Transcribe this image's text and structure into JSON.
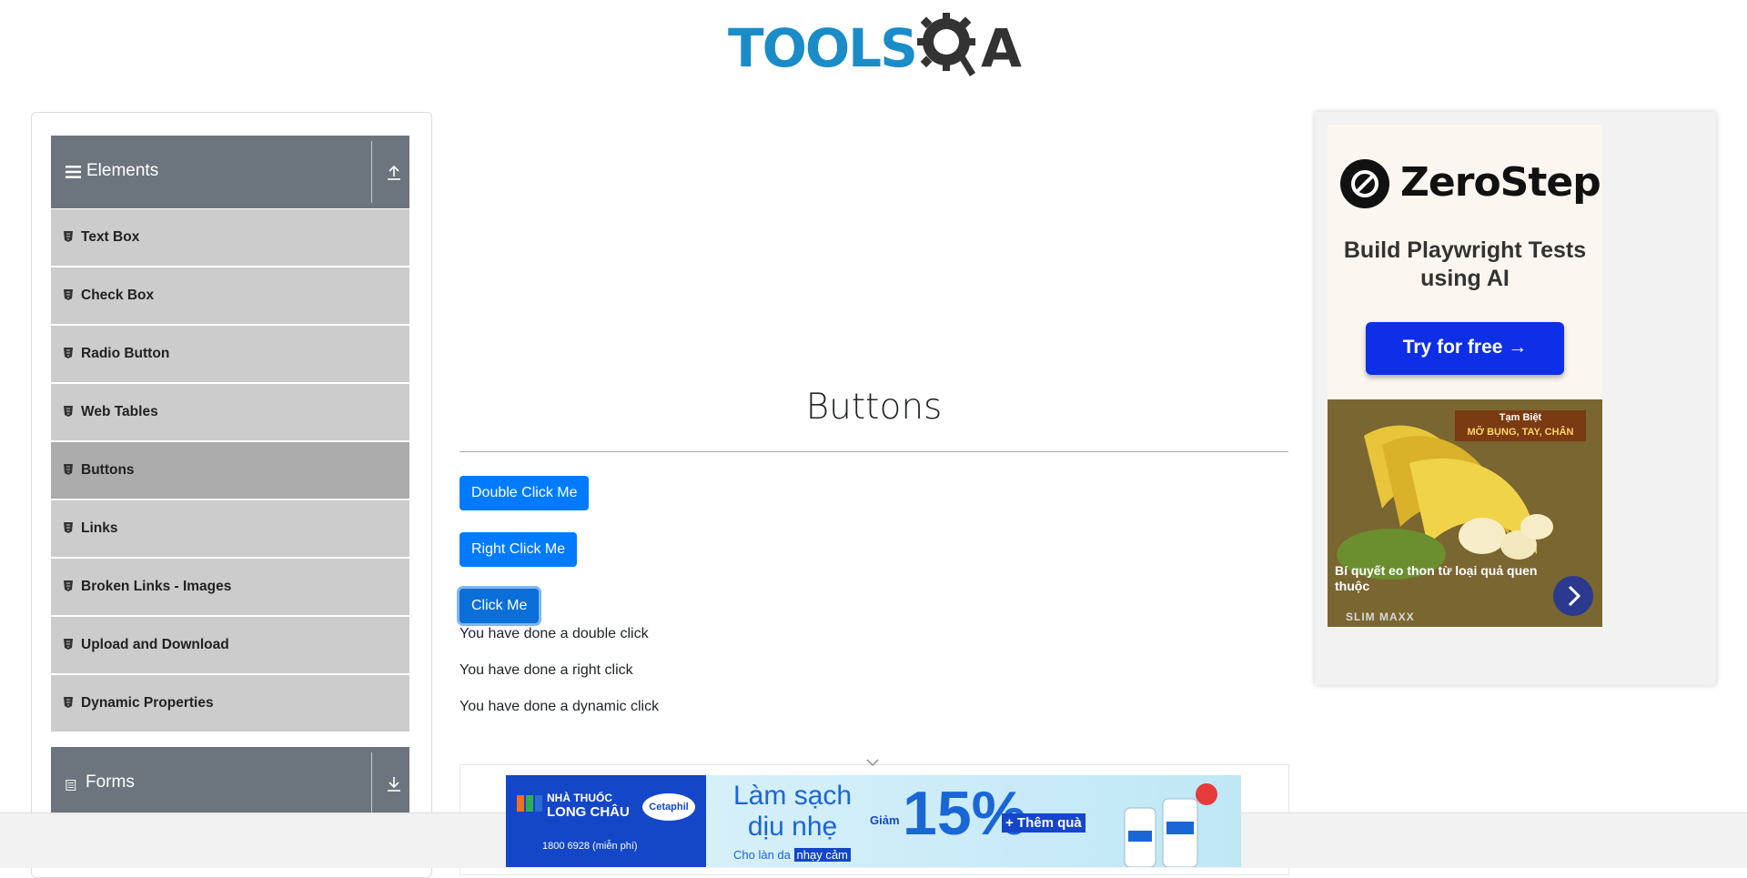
{
  "header": {
    "logo_text_left": "TOOLS",
    "logo_text_right": "QA"
  },
  "sidebar": {
    "groups": [
      {
        "title": "Elements",
        "expanded": true
      },
      {
        "title": "Forms",
        "expanded": false
      }
    ],
    "items": [
      {
        "label": "Text Box"
      },
      {
        "label": "Check Box"
      },
      {
        "label": "Radio Button"
      },
      {
        "label": "Web Tables"
      },
      {
        "label": "Buttons",
        "active": true
      },
      {
        "label": "Links"
      },
      {
        "label": "Broken Links - Images"
      },
      {
        "label": "Upload and Download"
      },
      {
        "label": "Dynamic Properties"
      }
    ]
  },
  "main": {
    "title": "Buttons",
    "buttons": {
      "double_click": "Double Click Me",
      "right_click": "Right Click Me",
      "click": "Click Me"
    },
    "messages": {
      "double": "You have done a double click",
      "right": "You have done a right click",
      "dynamic": "You have done a dynamic click"
    }
  },
  "right_ad": {
    "brand": "ZeroStep",
    "tagline": "Build Playwright Tests using AI",
    "cta": "Try for free →",
    "promo_badge_line1": "Tạm Biệt",
    "promo_badge_line2": "MỠ BỤNG, TAY, CHÂN",
    "promo_caption": "Bí quyết eo thon từ loại quả quen thuộc",
    "promo_brand": "SLIM MAXX"
  },
  "bottom_ad": {
    "pharmacy_line1": "NHÀ THUỐC",
    "pharmacy_line2": "LONG CHÂU",
    "partner": "Cetaphil",
    "phone": "1800 6928 (miễn phí)",
    "headline_line1": "Làm sạch",
    "headline_line2": "dịu nhẹ",
    "sub_text": "Cho làn da",
    "sub_highlight": "nhạy cảm",
    "discount_label": "Giảm",
    "discount_value": "15%",
    "gift": "+ Thêm quà"
  },
  "colors": {
    "primary_button": "#007bff",
    "sidebar_header": "#6c757d",
    "sidebar_item": "#cccccc",
    "sidebar_item_active": "#acacac",
    "logo_blue": "#1a8cc8",
    "zerostep_cta": "#0e2fe6"
  },
  "icons": {
    "elements_group": "hamburger-icon",
    "forms_group": "document-icon",
    "collapse": "upload-arrow-icon",
    "expand": "download-arrow-icon",
    "menu_item": "html5-shield-icon"
  }
}
